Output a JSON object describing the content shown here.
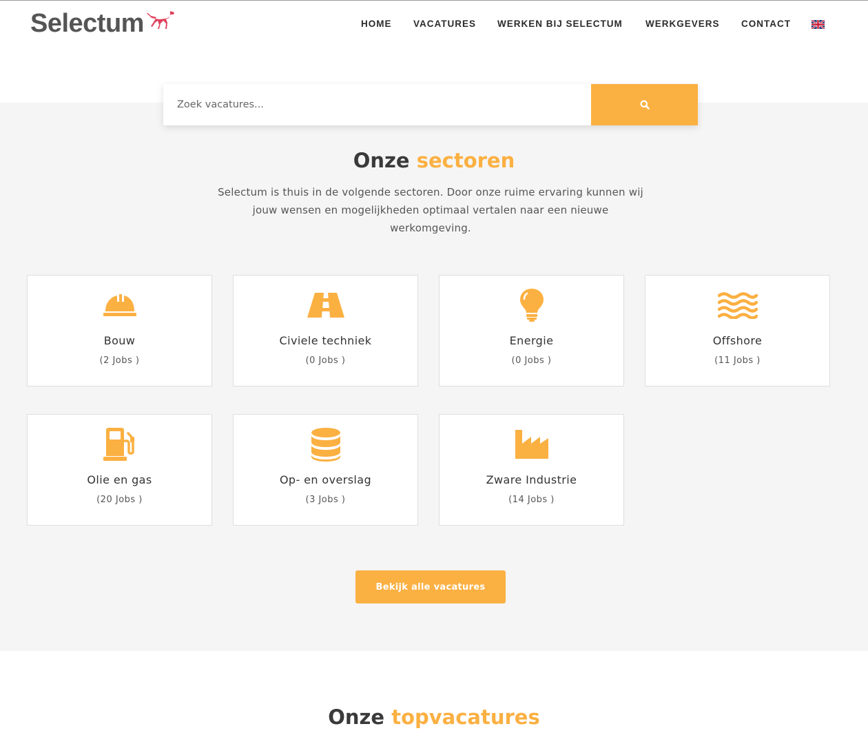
{
  "header": {
    "logo_text": "Selectum",
    "nav": [
      {
        "label": "HOME"
      },
      {
        "label": "VACATURES"
      },
      {
        "label": "WERKEN BIJ SELECTUM"
      },
      {
        "label": "WERKGEVERS"
      },
      {
        "label": "CONTACT"
      }
    ],
    "language_flag": "uk-flag-icon"
  },
  "search": {
    "placeholder": "Zoek vacatures...",
    "button_icon": "search-icon"
  },
  "sectors": {
    "title_plain": "Onze",
    "title_accent": "sectoren",
    "intro": "Selectum is thuis in de volgende sectoren. Door onze ruime ervaring kunnen wij jouw wensen en mogelijkheden optimaal vertalen naar een nieuwe werkomgeving.",
    "items": [
      {
        "name": "Bouw",
        "count": "(2 Jobs )",
        "icon": "hard-hat-icon"
      },
      {
        "name": "Civiele techniek",
        "count": "(0 Jobs )",
        "icon": "road-icon"
      },
      {
        "name": "Energie",
        "count": "(0 Jobs )",
        "icon": "lightbulb-icon"
      },
      {
        "name": "Offshore",
        "count": "(11 Jobs )",
        "icon": "water-waves-icon"
      },
      {
        "name": "Olie en gas",
        "count": "(20 Jobs )",
        "icon": "gas-pump-icon"
      },
      {
        "name": "Op- en overslag",
        "count": "(3 Jobs )",
        "icon": "database-stack-icon"
      },
      {
        "name": "Zware Industrie",
        "count": "(14 Jobs )",
        "icon": "factory-icon"
      }
    ],
    "cta_label": "Bekijk alle vacatures"
  },
  "topvacatures": {
    "title_plain": "Onze",
    "title_accent": "topvacatures"
  },
  "colors": {
    "accent": "#fbb042",
    "band": "#f5f5f5",
    "text": "#3a3a3a"
  }
}
